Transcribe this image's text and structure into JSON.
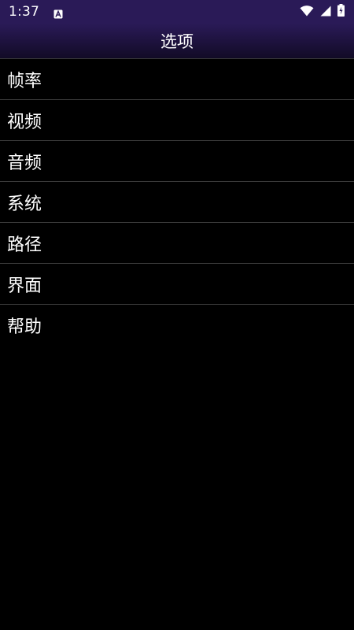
{
  "status_bar": {
    "time": "1:37",
    "notification_icon": "a-badge-icon",
    "wifi_icon": "wifi-icon",
    "signal_icon": "cell-signal-icon",
    "battery_icon": "battery-charging-icon",
    "background_color": "#2a1a57"
  },
  "header": {
    "title": "选项"
  },
  "menu": {
    "items": [
      {
        "label": "帧率"
      },
      {
        "label": "视频"
      },
      {
        "label": "音频"
      },
      {
        "label": "系统"
      },
      {
        "label": "路径"
      },
      {
        "label": "界面"
      },
      {
        "label": "帮助"
      }
    ]
  }
}
